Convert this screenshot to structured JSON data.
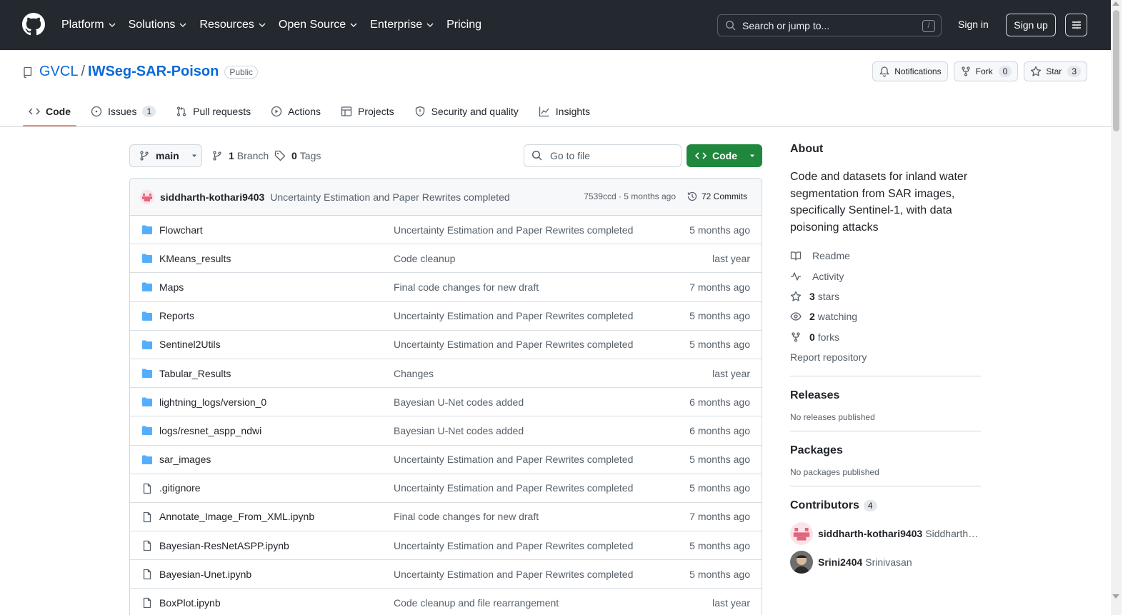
{
  "topnav": {
    "items": [
      {
        "label": "Platform",
        "dropdown": true
      },
      {
        "label": "Solutions",
        "dropdown": true
      },
      {
        "label": "Resources",
        "dropdown": true
      },
      {
        "label": "Open Source",
        "dropdown": true
      },
      {
        "label": "Enterprise",
        "dropdown": true
      },
      {
        "label": "Pricing",
        "dropdown": false
      }
    ],
    "search_placeholder": "Search or jump to...",
    "search_shortcut": "/",
    "sign_in": "Sign in",
    "sign_up": "Sign up"
  },
  "repo": {
    "owner": "GVCL",
    "separator": "/",
    "name": "IWSeg-SAR-Poison",
    "visibility": "Public",
    "notifications_label": "Notifications",
    "fork_label": "Fork",
    "fork_count": "0",
    "star_label": "Star",
    "star_count": "3"
  },
  "tabs": [
    {
      "label": "Code",
      "icon": "code-icon",
      "active": true
    },
    {
      "label": "Issues",
      "icon": "issue-icon",
      "count": "1"
    },
    {
      "label": "Pull requests",
      "icon": "pull-request-icon"
    },
    {
      "label": "Actions",
      "icon": "play-icon"
    },
    {
      "label": "Projects",
      "icon": "table-icon"
    },
    {
      "label": "Security and quality",
      "icon": "shield-icon"
    },
    {
      "label": "Insights",
      "icon": "graph-icon"
    }
  ],
  "browser": {
    "branch": "main",
    "branch_count": "1",
    "branch_label": "Branch",
    "tag_count": "0",
    "tag_label": "Tags",
    "goto_placeholder": "Go to file",
    "code_button": "Code",
    "commit": {
      "author": "siddharth-kothari9403",
      "message": "Uncertainty Estimation and Paper Rewrites completed",
      "meta": "7539ccd · 5 months ago",
      "commits_label": "72 Commits"
    },
    "files": [
      {
        "type": "folder",
        "name": "Flowchart",
        "message": "Uncertainty Estimation and Paper Rewrites completed",
        "age": "5 months ago"
      },
      {
        "type": "folder",
        "name": "KMeans_results",
        "message": "Code cleanup",
        "age": "last year"
      },
      {
        "type": "folder",
        "name": "Maps",
        "message": "Final code changes for new draft",
        "age": "7 months ago"
      },
      {
        "type": "folder",
        "name": "Reports",
        "message": "Uncertainty Estimation and Paper Rewrites completed",
        "age": "5 months ago"
      },
      {
        "type": "folder",
        "name": "Sentinel2Utils",
        "message": "Uncertainty Estimation and Paper Rewrites completed",
        "age": "5 months ago"
      },
      {
        "type": "folder",
        "name": "Tabular_Results",
        "message": "Changes",
        "age": "last year"
      },
      {
        "type": "folder",
        "name": "lightning_logs/version_0",
        "message": "Bayesian U-Net codes added",
        "age": "6 months ago"
      },
      {
        "type": "folder",
        "name": "logs/resnet_aspp_ndwi",
        "message": "Bayesian U-Net codes added",
        "age": "6 months ago"
      },
      {
        "type": "folder",
        "name": "sar_images",
        "message": "Uncertainty Estimation and Paper Rewrites completed",
        "age": "5 months ago"
      },
      {
        "type": "file",
        "name": ".gitignore",
        "message": "Uncertainty Estimation and Paper Rewrites completed",
        "age": "5 months ago"
      },
      {
        "type": "file",
        "name": "Annotate_Image_From_XML.ipynb",
        "message": "Final code changes for new draft",
        "age": "7 months ago"
      },
      {
        "type": "file",
        "name": "Bayesian-ResNetASPP.ipynb",
        "message": "Uncertainty Estimation and Paper Rewrites completed",
        "age": "5 months ago"
      },
      {
        "type": "file",
        "name": "Bayesian-Unet.ipynb",
        "message": "Uncertainty Estimation and Paper Rewrites completed",
        "age": "5 months ago"
      },
      {
        "type": "file",
        "name": "BoxPlot.ipynb",
        "message": "Code cleanup and file rearrangement",
        "age": "last year"
      }
    ]
  },
  "sidebar": {
    "about_title": "About",
    "about_text": "Code and datasets for inland water segmentation from SAR images, specifically Sentinel-1, with data poisoning attacks",
    "links": [
      {
        "icon": "book-icon",
        "bold": "",
        "label": "Readme"
      },
      {
        "icon": "pulse-icon",
        "bold": "",
        "label": "Activity"
      },
      {
        "icon": "star-icon",
        "bold": "3",
        "label": "stars"
      },
      {
        "icon": "eye-icon",
        "bold": "2",
        "label": "watching"
      },
      {
        "icon": "fork-icon",
        "bold": "0",
        "label": "forks"
      }
    ],
    "report": "Report repository",
    "releases_title": "Releases",
    "releases_text": "No releases published",
    "packages_title": "Packages",
    "packages_text": "No packages published",
    "contributors_title": "Contributors",
    "contributors_count": "4",
    "contributors": [
      {
        "login": "siddharth-kothari9403",
        "name": "Siddharth …"
      },
      {
        "login": "Srini2404",
        "name": "Srinivasan"
      }
    ]
  },
  "colors": {
    "header_bg": "#24292f",
    "link": "#0969da",
    "code_button": "#1f883d",
    "tab_underline": "#fd8c73",
    "folder": "#54aeff"
  }
}
